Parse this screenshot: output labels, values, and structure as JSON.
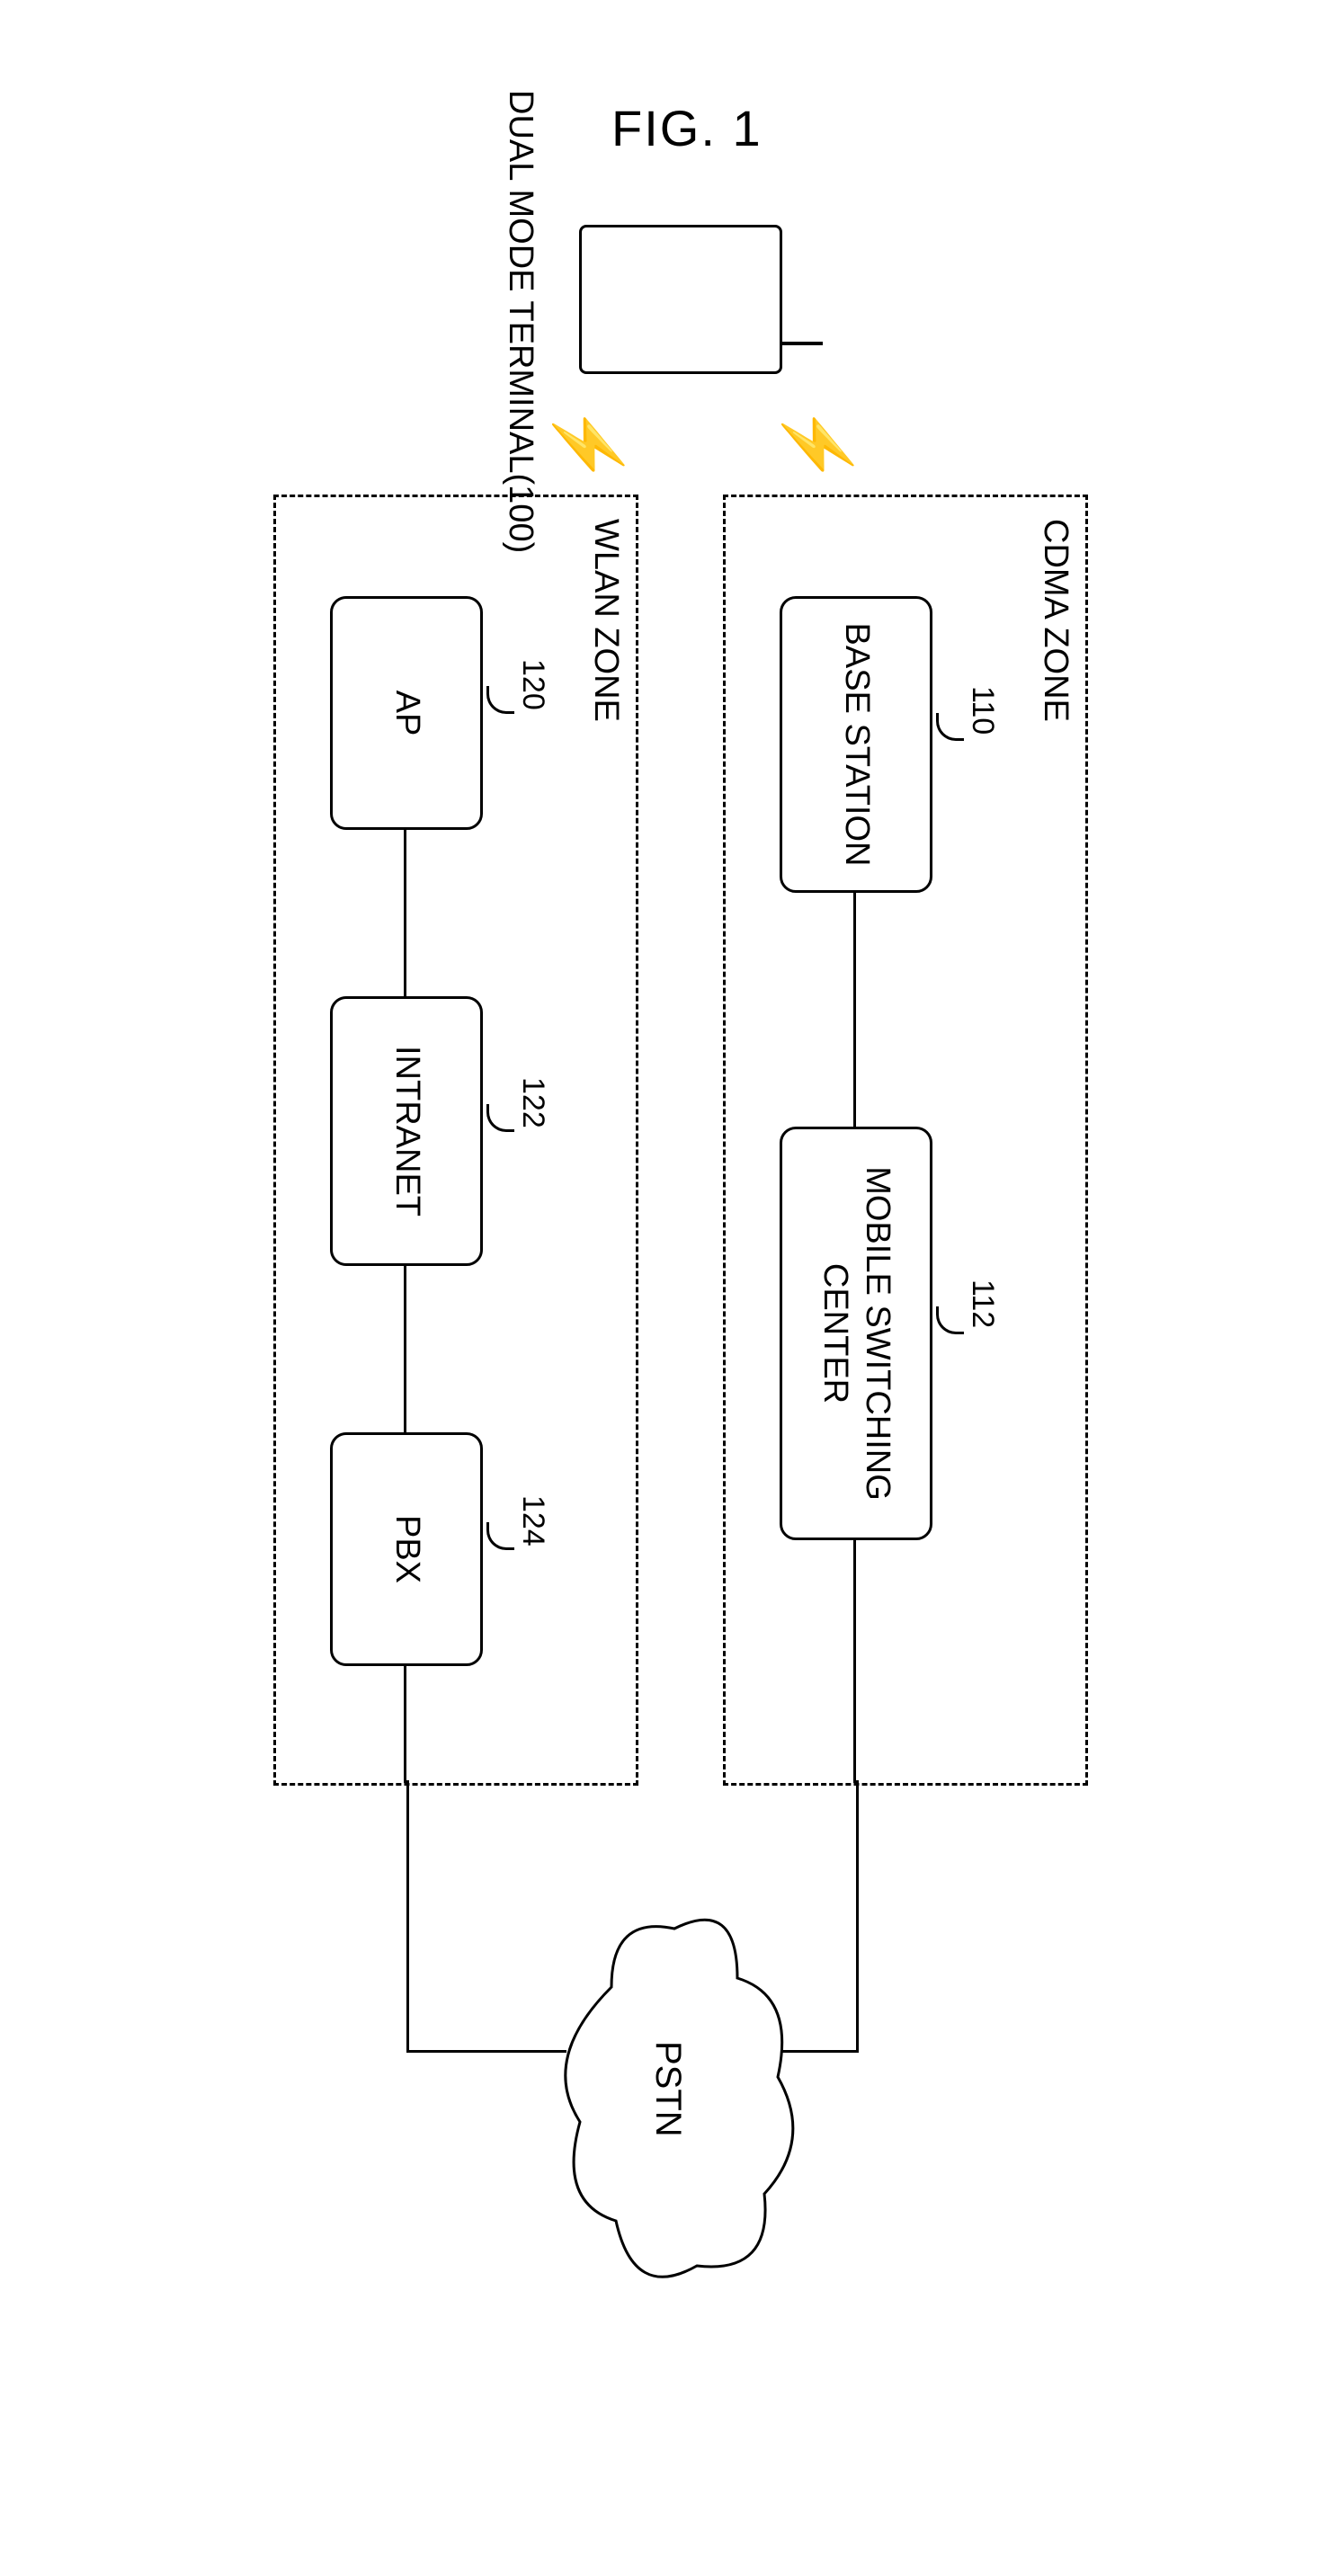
{
  "figure_label": "FIG. 1",
  "terminal": {
    "label": "DUAL MODE TERMINAL(100)"
  },
  "cdma_zone": {
    "label": "CDMA ZONE",
    "base_station": {
      "label": "BASE STATION",
      "ref": "110"
    },
    "msc": {
      "label": "MOBILE SWITCHING\nCENTER",
      "ref": "112"
    }
  },
  "wlan_zone": {
    "label": "WLAN ZONE",
    "ap": {
      "label": "AP",
      "ref": "120"
    },
    "intranet": {
      "label": "INTRANET",
      "ref": "122"
    },
    "pbx": {
      "label": "PBX",
      "ref": "124"
    }
  },
  "cloud": {
    "label": "PSTN"
  }
}
